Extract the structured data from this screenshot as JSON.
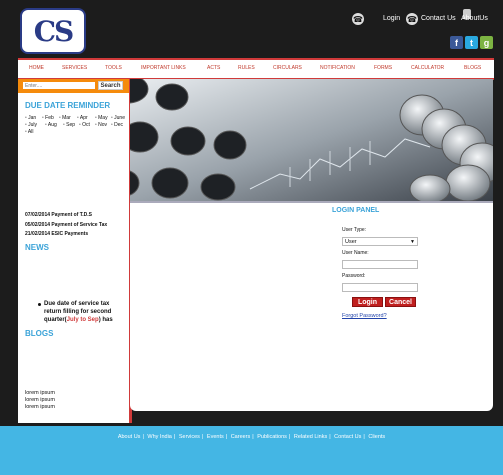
{
  "header": {
    "logo_text": "CS",
    "login_label": "Login",
    "contact_label": "Contact Us",
    "about_label": "AboutUs"
  },
  "nav": {
    "items": [
      "HOME",
      "SERVICES",
      "TOOLS",
      "IMPORTANT LINKS",
      "ACTS",
      "RULES",
      "CIRCULARS",
      "NOTIFICATION",
      "FORMS",
      "CALCULATOR",
      "BLOGS"
    ]
  },
  "sidebar": {
    "search_placeholder": "Enter....",
    "search_button": "Search",
    "due_date_title": "DUE DATE REMINDER",
    "months": [
      "Jan",
      "Feb",
      "Mar",
      "Apr",
      "May",
      "June",
      "July",
      "Aug",
      "Sep",
      "Oct",
      "Nov",
      "Dec",
      "All"
    ],
    "payments": [
      "07/02/2014 Payment of T.D.S",
      "05/02/2014 Payment of Service Tax",
      "21/02/2014 ESIC Payments"
    ],
    "news_title": "NEWS",
    "news_text_before": "Due date of service tax return filling for second quarter(",
    "news_highlight": "July to Sep",
    "news_text_after": ") has",
    "blogs_title": "BLOGS",
    "blog_lines": [
      "lorem ipsum",
      "lorem ipsum",
      "lorem ipsum"
    ]
  },
  "login": {
    "title": "LOGIN PANEL",
    "user_type_label": "User Type:",
    "user_type_value": "User",
    "user_name_label": "User Name:",
    "password_label": "Password:",
    "login_button": "Login",
    "cancel_button": "Cancel",
    "forgot_link": "Forgot Password?"
  },
  "footer": {
    "links": [
      "About Us",
      "Why India",
      "Services",
      "Events",
      "Careers",
      "Publications",
      "Related Links",
      "Contact Us",
      "Clients"
    ]
  },
  "colors": {
    "accent_red": "#d03a3a",
    "accent_blue": "#3ba3d8",
    "footer_blue": "#44b6e4",
    "search_orange": "#f58b0c"
  }
}
